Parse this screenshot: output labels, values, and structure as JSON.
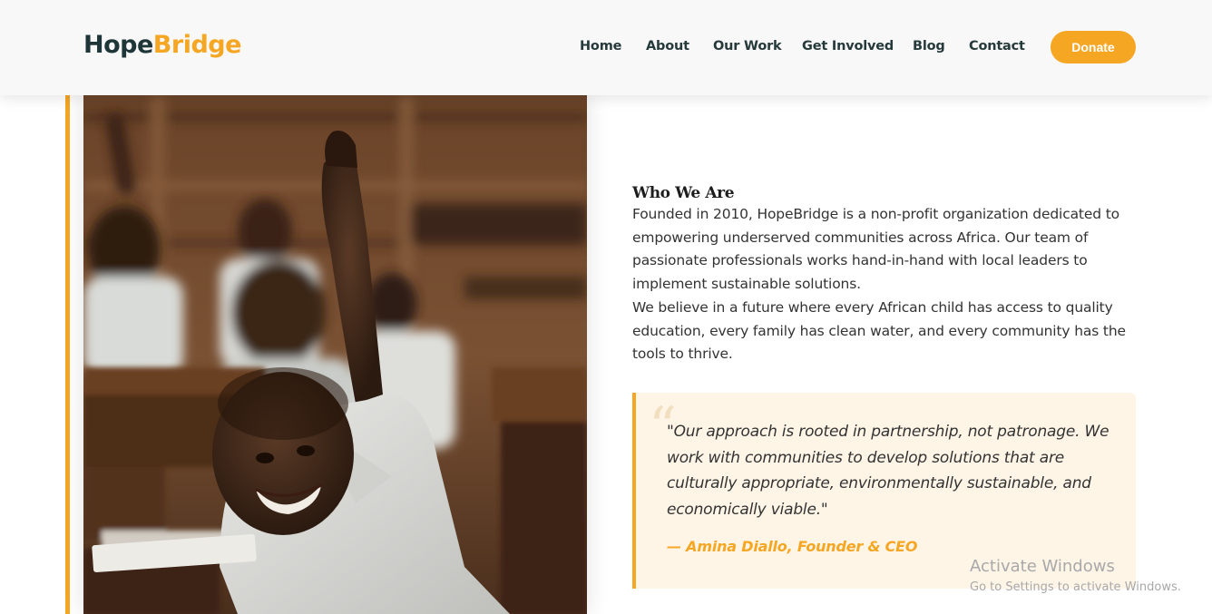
{
  "brand": {
    "part1": "Hope",
    "part2": "Bridge",
    "accent_color": "#f5a623",
    "dark_color": "#1e3638"
  },
  "nav": {
    "items": [
      "Home",
      "About",
      "Our Work",
      "Get Involved",
      "Blog",
      "Contact"
    ],
    "donate_label": "Donate"
  },
  "hero_image": {
    "alt": "Smiling child raising hand in classroom"
  },
  "about": {
    "heading": "Who We Are",
    "paragraph1": "Founded in 2010, HopeBridge is a non-profit organization dedicated to empowering underserved communities across Africa. Our team of passionate professionals works hand-in-hand with local leaders to implement sustainable solutions.",
    "paragraph2": "We believe in a future where every African child has access to quality education, every family has clean water, and every community has the tools to thrive."
  },
  "quote": {
    "mark": "“",
    "text": "\"Our approach is rooted in partnership, not patronage. We work with communities to develop solutions that are culturally appropriate, environmentally sustainable, and economically viable.\"",
    "author": "— Amina Diallo, Founder & CEO"
  },
  "watermark": {
    "title": "Activate Windows",
    "subtitle": "Go to Settings to activate Windows."
  }
}
